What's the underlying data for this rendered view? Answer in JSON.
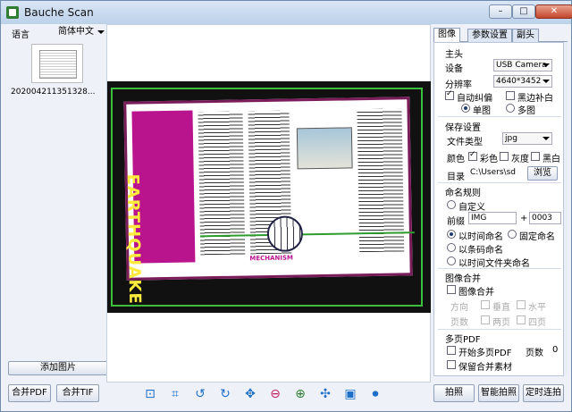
{
  "window": {
    "title": "Bauche Scan",
    "minimize": "–",
    "maximize": "□",
    "close": "✕"
  },
  "left": {
    "lang_label": "语言",
    "lang_value": "简体中文",
    "thumb_label": "202004211351328...",
    "add_image": "添加图片"
  },
  "preview": {
    "poster_title": "EARTHQUAKE",
    "section": "MECHANISM"
  },
  "bottom": {
    "merge_pdf": "合并PDF",
    "merge_tif": "合并TIF",
    "capture": "拍照",
    "smart_capture": "智能拍照",
    "timed_capture": "定时连拍"
  },
  "tools": [
    "crop-select-icon",
    "crop-icon",
    "rotate-left-icon",
    "rotate-right-icon",
    "move-icon",
    "zoom-out-icon",
    "zoom-in-icon",
    "fit-icon",
    "fullscreen-icon",
    "video-icon"
  ],
  "tabs": [
    "图像",
    "参数设置",
    "副头"
  ],
  "main": {
    "header": "主头",
    "device_label": "设备",
    "device_value": "USB Camera",
    "resolution_label": "分辨率",
    "resolution_value": "4640*3452",
    "auto_deskew": "自动纠偏",
    "black_fill": "黑边补白",
    "single": "单图",
    "multi": "多图"
  },
  "save": {
    "header": "保存设置",
    "filetype_label": "文件类型",
    "filetype_value": "jpg",
    "color_label": "颜色",
    "color": "彩色",
    "gray": "灰度",
    "bw": "黑白",
    "dir_label": "目录",
    "dir_value": "C:\\Users\\sd",
    "browse": "浏览"
  },
  "naming": {
    "header": "命名规则",
    "custom": "自定义",
    "prefix_label": "前缀",
    "prefix_value": "IMG",
    "plus": "+",
    "counter_value": "0003",
    "by_time": "以时间命名",
    "fixed": "固定命名",
    "by_barcode": "以条码命名",
    "by_time_folder": "以时间文件夹命名"
  },
  "merge": {
    "header": "图像合并",
    "merge": "图像合并",
    "direction": "方向",
    "vertical": "垂直",
    "horizontal": "水平",
    "pages": "页数",
    "two_pages": "两页",
    "four_pages": "四页"
  },
  "multipdf": {
    "header": "多页PDF",
    "start": "开始多页PDF",
    "pages_label": "页数",
    "pages_value": "0",
    "keep": "保留合并素材"
  }
}
